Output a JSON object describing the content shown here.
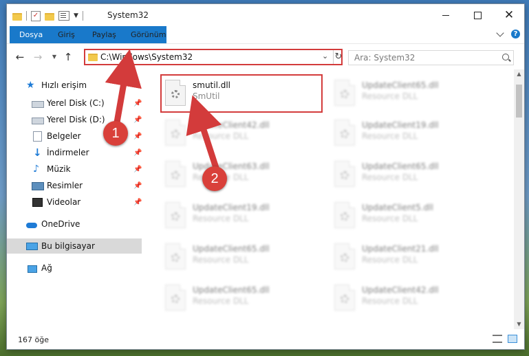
{
  "window": {
    "title": "System32",
    "controls": {
      "minimize": "minimize",
      "maximize": "maximize",
      "close": "✕"
    }
  },
  "ribbon": {
    "tabs": [
      {
        "label": "Dosya"
      },
      {
        "label": "Giriş"
      },
      {
        "label": "Paylaş"
      },
      {
        "label": "Görünüm"
      }
    ],
    "help": "?"
  },
  "address": {
    "path": "C:\\Windows\\System32"
  },
  "search": {
    "placeholder": "Ara: System32"
  },
  "nav": {
    "quick_access": "Hızlı erişim",
    "items": [
      {
        "label": "Yerel Disk (C:)",
        "icon": "disk-icon"
      },
      {
        "label": "Yerel Disk (D:)",
        "icon": "disk-icon"
      },
      {
        "label": "Belgeler",
        "icon": "documents-icon"
      },
      {
        "label": "İndirmeler",
        "icon": "downloads-icon"
      },
      {
        "label": "Müzik",
        "icon": "music-icon"
      },
      {
        "label": "Resimler",
        "icon": "pictures-icon"
      },
      {
        "label": "Videolar",
        "icon": "videos-icon"
      }
    ],
    "onedrive": "OneDrive",
    "this_pc": "Bu bilgisayar",
    "network": "Ağ"
  },
  "files": {
    "highlighted": {
      "name": "smutil.dll",
      "desc": "SmUtil"
    },
    "blurred": [
      {
        "name": "UpdateClient65.dll",
        "desc": "Resource DLL"
      },
      {
        "name": "UpdateClient42.dll",
        "desc": "Resource DLL"
      },
      {
        "name": "UpdateClient19.dll",
        "desc": "Resource DLL"
      },
      {
        "name": "UpdateClient63.dll",
        "desc": "Resource DLL"
      },
      {
        "name": "UpdateClient65.dll",
        "desc": "Resource DLL"
      },
      {
        "name": "UpdateClient19.dll",
        "desc": "Resource DLL"
      },
      {
        "name": "UpdateClient5.dll",
        "desc": "Resource DLL"
      },
      {
        "name": "UpdateClient65.dll",
        "desc": "Resource DLL"
      },
      {
        "name": "UpdateClient21.dll",
        "desc": "Resource DLL"
      },
      {
        "name": "UpdateClient65.dll",
        "desc": "Resource DLL"
      },
      {
        "name": "UpdateClient42.dll",
        "desc": "Resource DLL"
      }
    ]
  },
  "status": {
    "count": "167 öğe"
  },
  "annotations": {
    "step1": "1",
    "step2": "2",
    "color": "#d33b3b"
  }
}
